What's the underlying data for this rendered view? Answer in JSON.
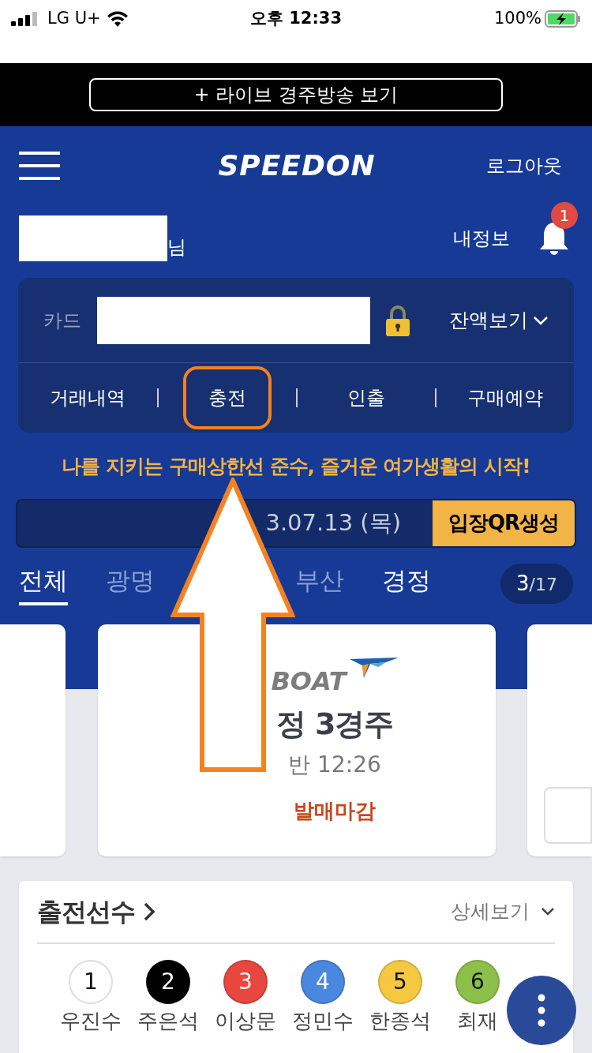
{
  "status_bar": {
    "carrier": "LG U+",
    "time": "오후 12:33",
    "battery": "100%"
  },
  "live_button": "+ 라이브 경주방송 보기",
  "header": {
    "logo": "SPEEDON",
    "logout": "로그아웃"
  },
  "user": {
    "suffix": "님",
    "my_info": "내정보",
    "notifications": "1"
  },
  "card_panel": {
    "label": "카드",
    "balance": "잔액보기",
    "actions": [
      {
        "label": "거래내역",
        "highlighted": false
      },
      {
        "label": "충전",
        "highlighted": true
      },
      {
        "label": "인출",
        "highlighted": false
      },
      {
        "label": "구매예약",
        "highlighted": false
      }
    ]
  },
  "notice": "나를 지키는 구매상한선 준수, 즐거운 여가생활의 시작!",
  "date_bar": {
    "date": "3.07.13 (목)",
    "qr_button": "입장QR생성"
  },
  "venue_tabs": [
    {
      "label": "전체",
      "selected": true
    },
    {
      "label": "광명",
      "selected": false
    },
    {
      "label": "부산",
      "selected": false
    },
    {
      "label": "경정",
      "selected": false
    }
  ],
  "page_counter": {
    "current": "3",
    "total": "/17"
  },
  "race_card": {
    "logo": "BOAT",
    "title": "정 3경주",
    "time": "반 12:26",
    "status": "발매마감"
  },
  "racers_section": {
    "title": "출전선수",
    "detail": "상세보기",
    "racers": [
      {
        "number": "1",
        "name": "우진수",
        "color": "#ffffff"
      },
      {
        "number": "2",
        "name": "주은석",
        "color": "#000000"
      },
      {
        "number": "3",
        "name": "이상문",
        "color": "#e8473f"
      },
      {
        "number": "4",
        "name": "정민수",
        "color": "#4a88e0"
      },
      {
        "number": "5",
        "name": "한종석",
        "color": "#f5c842"
      },
      {
        "number": "6",
        "name": "최재",
        "color": "#8dc04a"
      }
    ]
  }
}
